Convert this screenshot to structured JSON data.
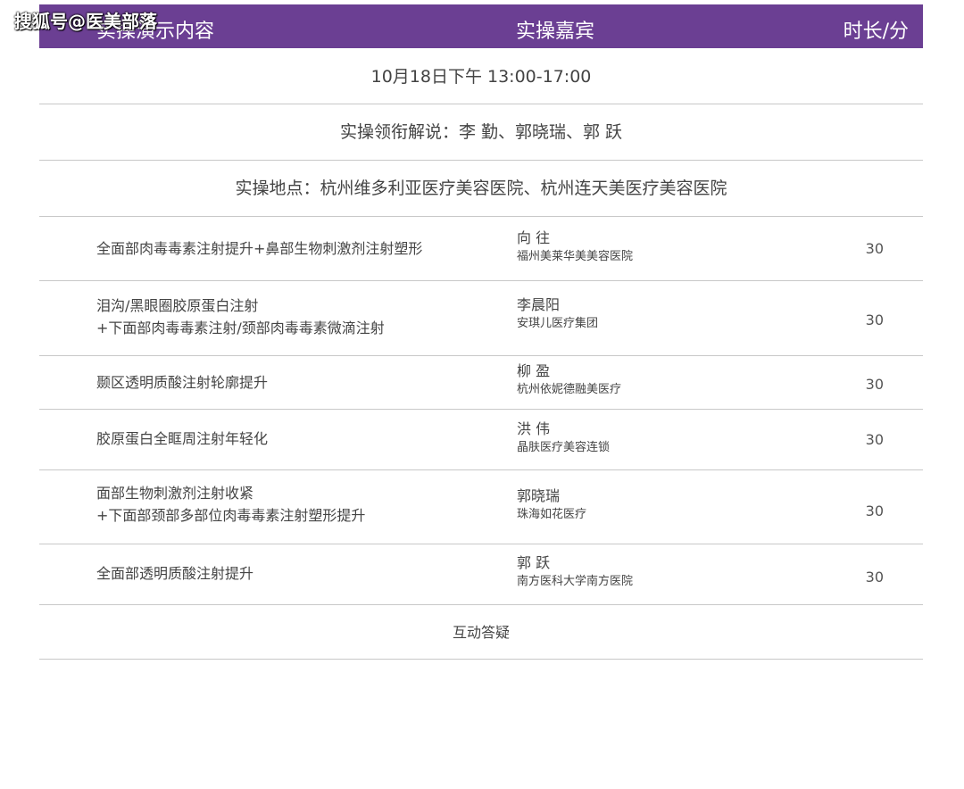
{
  "watermark": "搜狐号@医美部落",
  "header": {
    "col1": "实操演示内容",
    "col2": "实操嘉宾",
    "col3": "时长/分"
  },
  "schedule": {
    "date_line": "10月18日下午  13:00-17:00",
    "lead_line": "实操领衔解说：李  勤、郭晓瑞、郭  跃",
    "venue_line": "实操地点：杭州维多利亚医疗美容医院、杭州连天美医疗美容医院"
  },
  "items": [
    {
      "topic_line1": "全面部肉毒毒素注射提升+鼻部生物刺激剂注射塑形",
      "topic_line2": "",
      "guest_name": "向  往",
      "guest_org": "福州美莱华美美容医院",
      "duration": "30"
    },
    {
      "topic_line1": "泪沟/黑眼圈胶原蛋白注射",
      "topic_line2": "+下面部肉毒毒素注射/颈部肉毒毒素微滴注射",
      "guest_name": "李晨阳",
      "guest_org": "安琪儿医疗集团",
      "duration": "30"
    },
    {
      "topic_line1": "颞区透明质酸注射轮廓提升",
      "topic_line2": "",
      "guest_name": "柳  盈",
      "guest_org": "杭州依妮德融美医疗",
      "duration": "30"
    },
    {
      "topic_line1": "胶原蛋白全眶周注射年轻化",
      "topic_line2": "",
      "guest_name": "洪  伟",
      "guest_org": "晶肤医疗美容连锁",
      "duration": "30"
    },
    {
      "topic_line1": "面部生物刺激剂注射收紧",
      "topic_line2": "+下面部颈部多部位肉毒毒素注射塑形提升",
      "guest_name": "郭晓瑞",
      "guest_org": "珠海如花医疗",
      "duration": "30"
    },
    {
      "topic_line1": "全面部透明质酸注射提升",
      "topic_line2": "",
      "guest_name": "郭  跃",
      "guest_org": "南方医科大学南方医院",
      "duration": "30"
    }
  ],
  "qa": "互动答疑"
}
